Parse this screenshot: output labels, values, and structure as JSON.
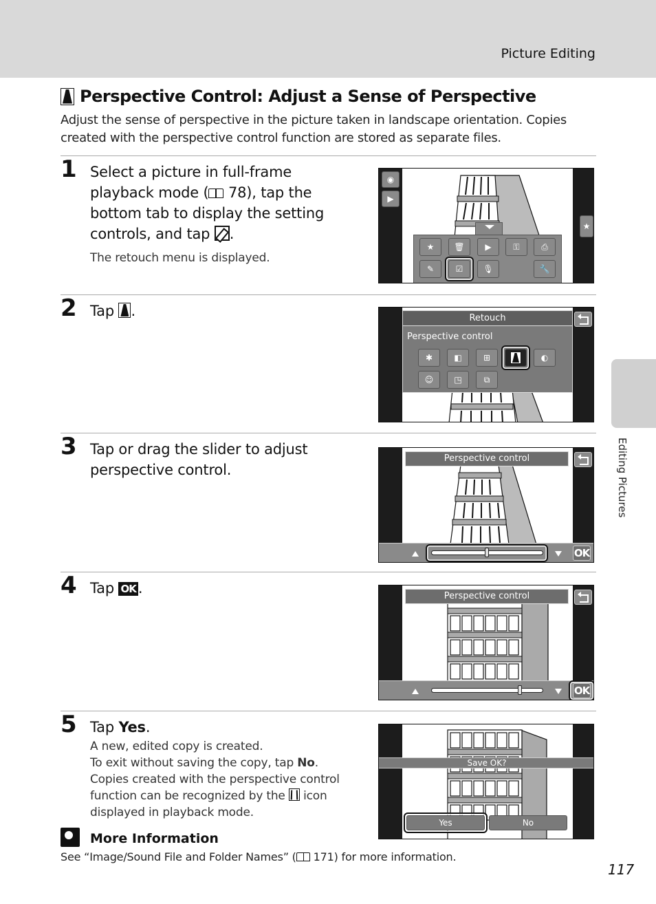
{
  "header": {
    "section": "Picture Editing"
  },
  "title": "Perspective Control: Adjust a Sense of Perspective",
  "intro": "Adjust the sense of perspective in the picture taken in landscape orientation. Copies created with the perspective control function are stored as separate files.",
  "steps": [
    {
      "number": "1",
      "text_a": "Select a picture in full-frame playback mode (",
      "ref_page": "78",
      "text_b": "), tap the bottom tab to display the setting controls, and tap ",
      "text_c": ".",
      "sub": "The retouch menu is displayed.",
      "screen": {
        "left_icons": [
          "camera-icon",
          "playback-icon"
        ],
        "right_icon": "star-icon",
        "menu_icons_row1": [
          "favorite-folder-icon",
          "delete-icon",
          "slideshow-icon",
          "protect-key-icon",
          "print-icon"
        ],
        "menu_icons_row2": [
          "pencil-draw-icon",
          "retouch-icon",
          "voice-memo-icon",
          "",
          "setup-wrench-icon"
        ],
        "selected": "retouch-icon"
      }
    },
    {
      "number": "2",
      "text_a": "Tap ",
      "text_c": ".",
      "screen": {
        "menu_title": "Retouch",
        "item_label": "Perspective control",
        "icons_row1": [
          "quick-retouch-icon",
          "glamour-retouch-icon",
          "d-lighting-icon",
          "perspective-control-icon",
          "filter-effects-icon"
        ],
        "icons_row2": [
          "skin-softening-icon",
          "small-picture-icon",
          "crop-icon"
        ],
        "selected": "perspective-control-icon"
      }
    },
    {
      "number": "3",
      "text": "Tap or drag the slider to adjust perspective control.",
      "screen": {
        "title": "Perspective control",
        "ok_label": "OK",
        "slider_value": 0.5
      }
    },
    {
      "number": "4",
      "text_a": "Tap ",
      "ok_label": "OK",
      "text_c": ".",
      "screen": {
        "title": "Perspective control",
        "ok_label": "OK",
        "slider_value": 0.8
      }
    },
    {
      "number": "5",
      "text_a": "Tap ",
      "text_bold": "Yes",
      "text_c": ".",
      "sub1": "A new, edited copy is created.",
      "sub2_a": "To exit without saving the copy, tap ",
      "sub2_bold": "No",
      "sub2_c": ".",
      "sub3_a": "Copies created with the perspective control function can be recognized by the ",
      "sub3_b": " icon displayed in playback mode.",
      "screen": {
        "prompt": "Save OK?",
        "yes_label": "Yes",
        "no_label": "No"
      }
    }
  ],
  "more_info": {
    "title": "More Information",
    "text_a": "See “Image/Sound File and Folder Names” (",
    "ref_page": "171",
    "text_b": ") for more information."
  },
  "side_tab": "Editing Pictures",
  "page_number": "117"
}
